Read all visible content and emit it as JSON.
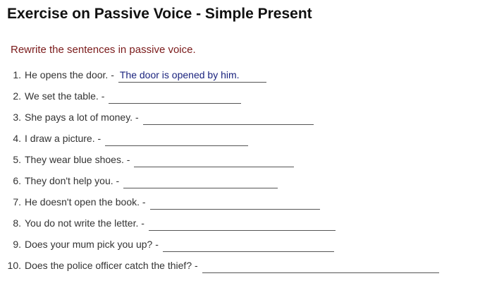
{
  "page": {
    "title": "Exercise on Passive Voice - Simple Present",
    "instruction": "Rewrite the sentences in passive voice."
  },
  "items": [
    {
      "num": "1.",
      "sentence": "He opens the door.",
      "sep": "-",
      "answer": "The door is opened by him."
    },
    {
      "num": "2.",
      "sentence": "We set the table.",
      "sep": "-",
      "answer": ""
    },
    {
      "num": "3.",
      "sentence": "She pays a lot of money.",
      "sep": "-",
      "answer": ""
    },
    {
      "num": "4.",
      "sentence": "I draw a picture.",
      "sep": "-",
      "answer": ""
    },
    {
      "num": "5.",
      "sentence": "They wear blue shoes.",
      "sep": "-",
      "answer": ""
    },
    {
      "num": "6.",
      "sentence": "They don't help you.",
      "sep": "-",
      "answer": ""
    },
    {
      "num": "7.",
      "sentence": "He doesn't open the book.",
      "sep": "-",
      "answer": ""
    },
    {
      "num": "8.",
      "sentence": "You do not write the letter.",
      "sep": "-",
      "answer": ""
    },
    {
      "num": "9.",
      "sentence": "Does your mum pick you up?",
      "sep": "-",
      "answer": ""
    },
    {
      "num": "10.",
      "sentence": "Does the police officer catch the thief?",
      "sep": "-",
      "answer": ""
    }
  ]
}
